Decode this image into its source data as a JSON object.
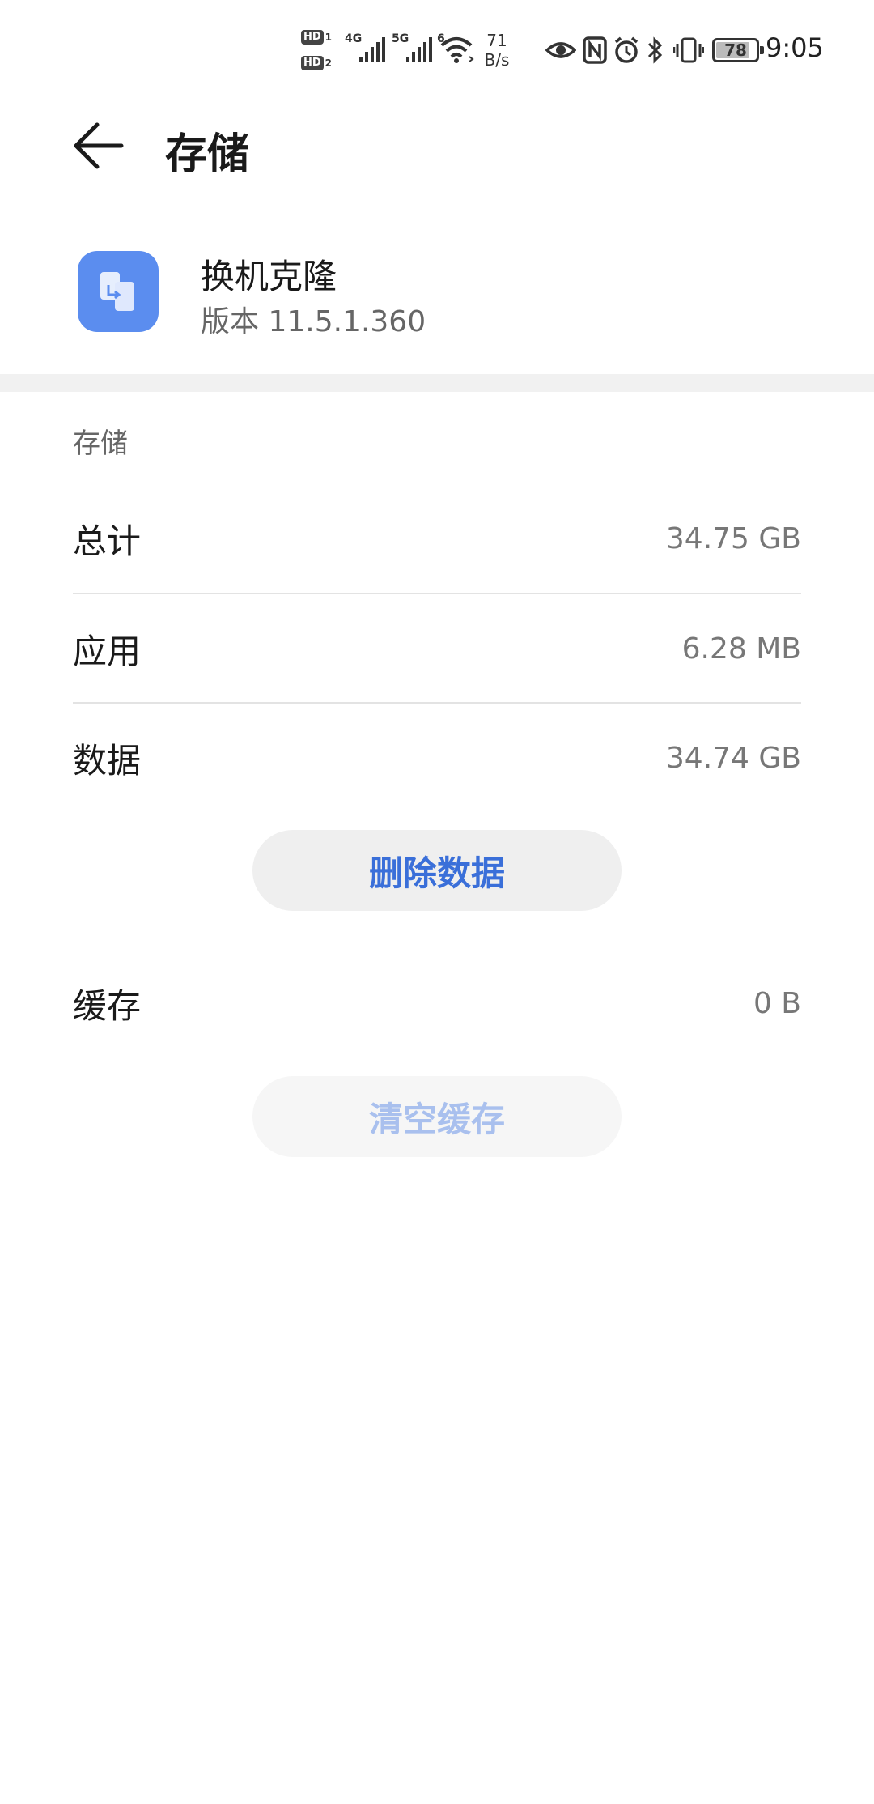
{
  "status_bar": {
    "hd_label": "HD",
    "sim1": "1",
    "sim2": "2",
    "network1": "4G",
    "network2": "5G",
    "wifi_gen": "6",
    "speed_value": "71",
    "speed_unit": "B/s",
    "battery": "78",
    "battery_level": 0.78,
    "time": "9:05"
  },
  "header": {
    "title": "存储"
  },
  "app": {
    "name": "换机克隆",
    "version": "版本 11.5.1.360",
    "icon_color": "#5b8def"
  },
  "storage": {
    "section_label": "存储",
    "rows": [
      {
        "label": "总计",
        "value": "34.75 GB"
      },
      {
        "label": "应用",
        "value": "6.28 MB"
      },
      {
        "label": "数据",
        "value": "34.74 GB"
      }
    ],
    "delete_data_label": "删除数据"
  },
  "cache": {
    "label": "缓存",
    "value": "0 B",
    "clear_cache_label": "清空缓存"
  },
  "colors": {
    "accent": "#3a6fd9",
    "disabled_accent": "#a9c0ee"
  }
}
